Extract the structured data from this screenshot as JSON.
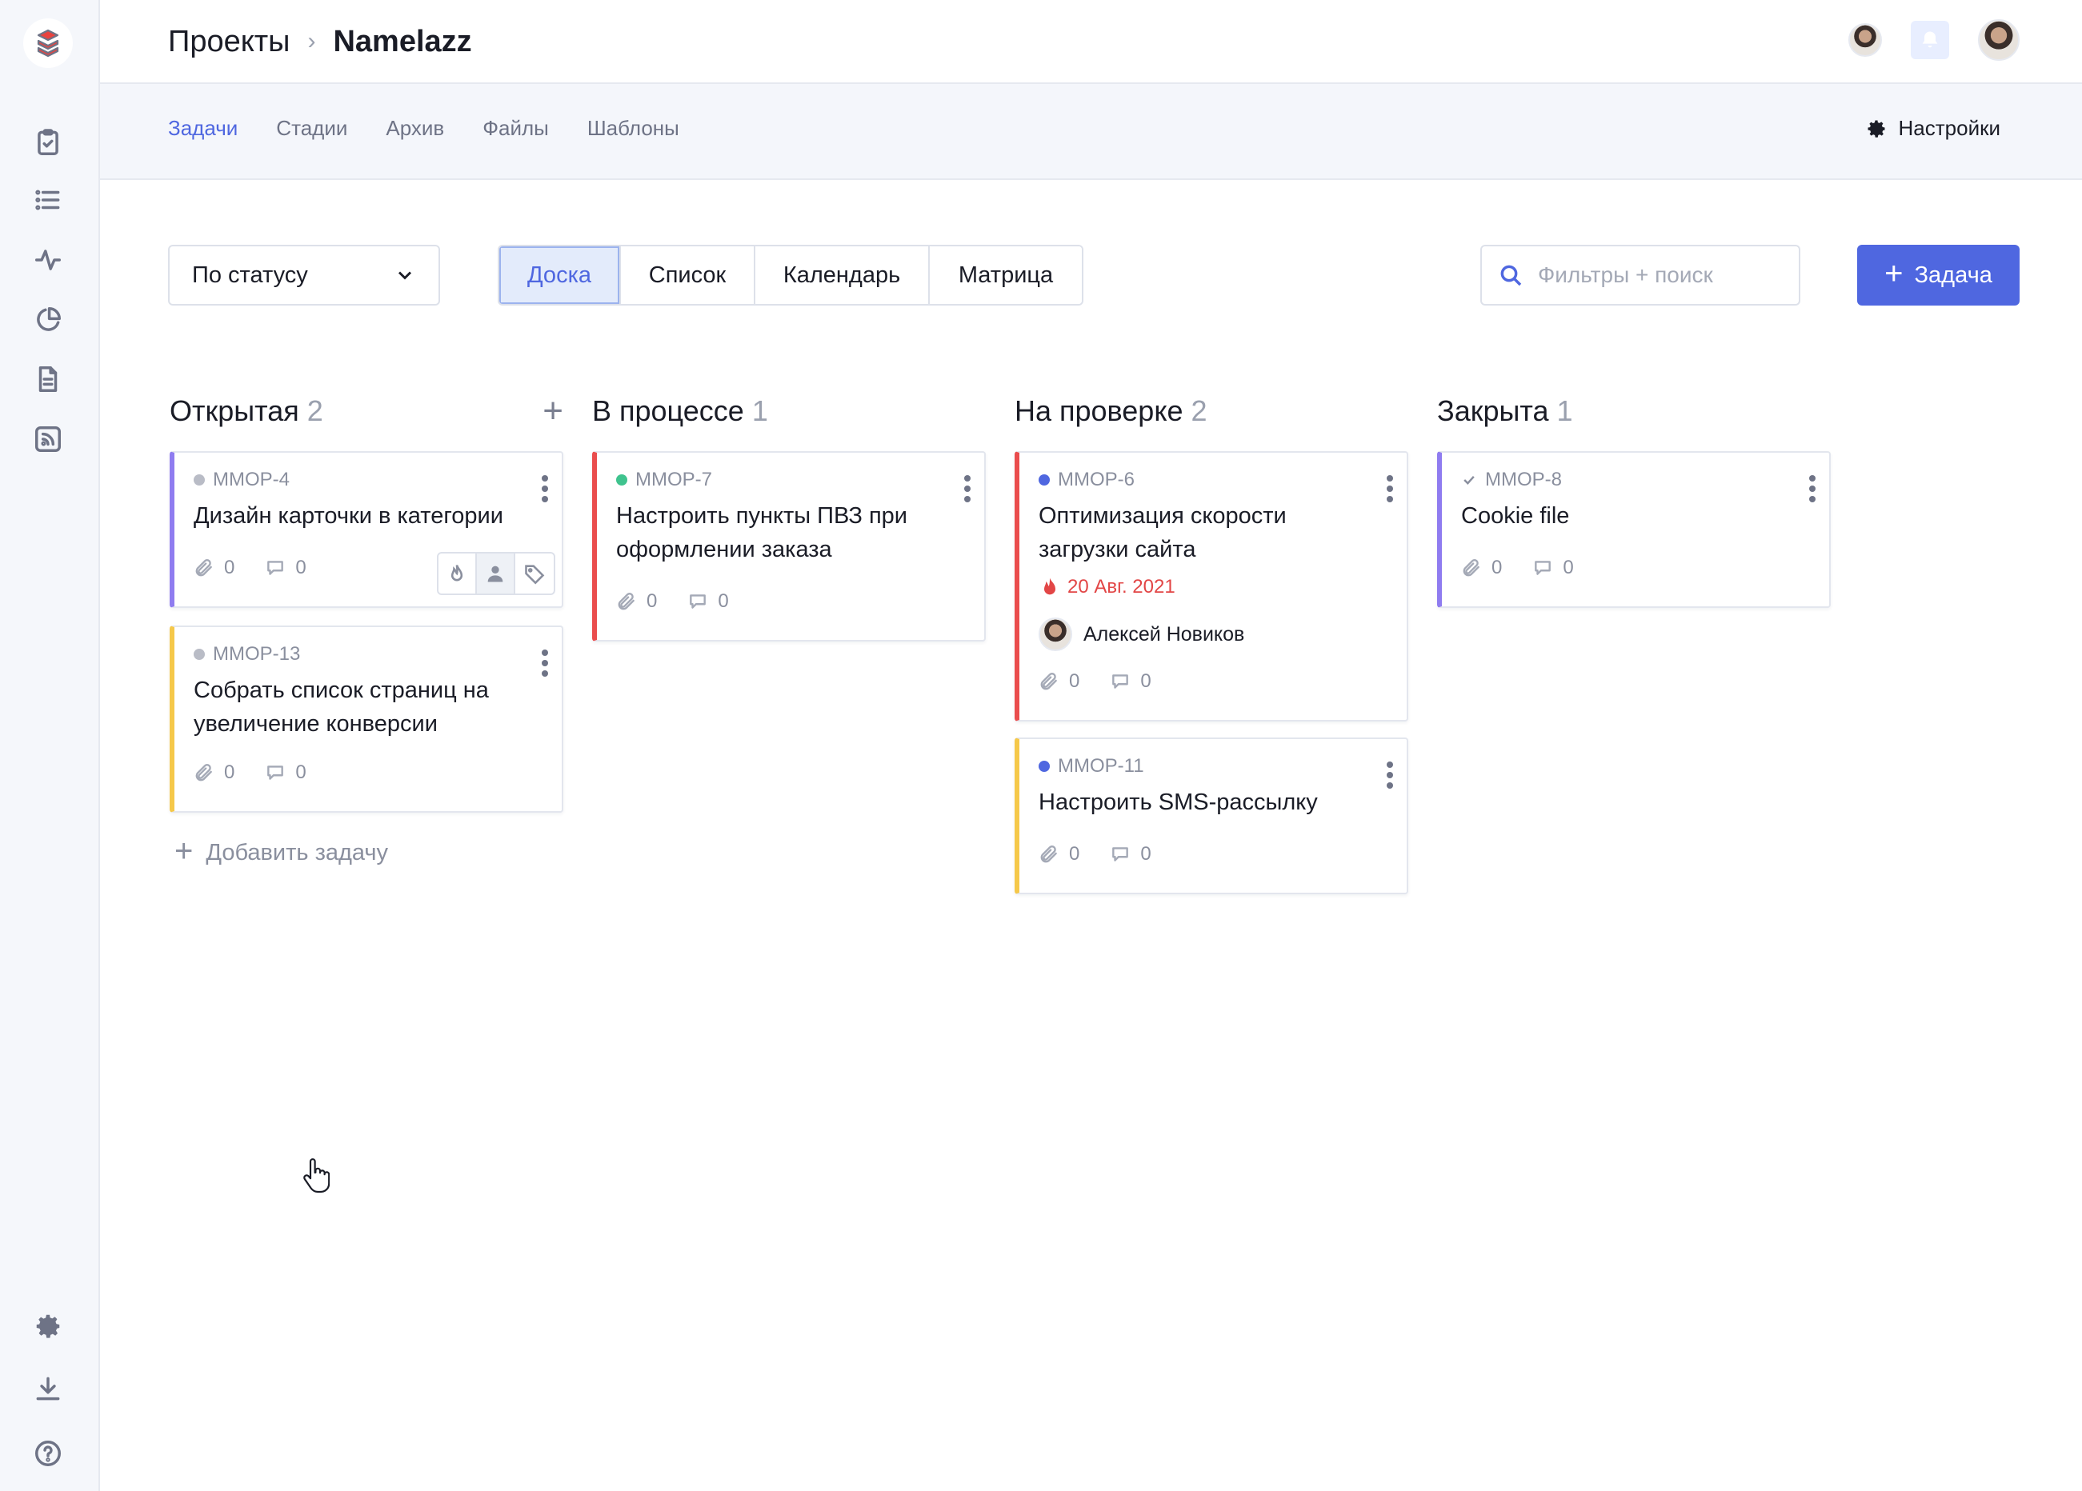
{
  "breadcrumb": {
    "root": "Проекты",
    "current": "Namelazz"
  },
  "tabs": [
    {
      "label": "Задачи",
      "active": true
    },
    {
      "label": "Стадии",
      "active": false
    },
    {
      "label": "Архив",
      "active": false
    },
    {
      "label": "Файлы",
      "active": false
    },
    {
      "label": "Шаблоны",
      "active": false
    }
  ],
  "settings_label": "Настройки",
  "toolbar": {
    "group_by": "По статусу",
    "views": [
      "Доска",
      "Список",
      "Календарь",
      "Матрица"
    ],
    "active_view": "Доска",
    "search_placeholder": "Фильтры + поиск",
    "add_task_label": "Задача"
  },
  "columns": [
    {
      "title": "Открытая",
      "count": "2",
      "cards": [
        {
          "code": "MMOP-4",
          "status_dot": "#b9bcc6",
          "title": "Дизайн карточки в категории",
          "border": "#8f7cf0",
          "attachments": "0",
          "comments": "0"
        },
        {
          "code": "MMOP-13",
          "status_dot": "#b9bcc6",
          "title": "Собрать список страниц на увеличение конверсии",
          "border": "#f5c84a",
          "attachments": "0",
          "comments": "0"
        }
      ],
      "add_label": "Добавить задачу"
    },
    {
      "title": "В процессе",
      "count": "1",
      "cards": [
        {
          "code": "MMOP-7",
          "status_dot": "#3fc38e",
          "title": "Настроить пункты ПВЗ при оформлении заказа",
          "border": "#ea4d4d",
          "attachments": "0",
          "comments": "0"
        }
      ]
    },
    {
      "title": "На проверке",
      "count": "2",
      "cards": [
        {
          "code": "MMOP-6",
          "status_dot": "#4f67e0",
          "title": "Оптимизация скорости загрузки сайта",
          "border": "#ea4d4d",
          "due": "20 Авг. 2021",
          "assignee": "Алексей Новиков",
          "attachments": "0",
          "comments": "0"
        },
        {
          "code": "MMOP-11",
          "status_dot": "#4f67e0",
          "title": "Настроить SMS-рассылку",
          "border": "#f5c84a",
          "attachments": "0",
          "comments": "0"
        }
      ]
    },
    {
      "title": "Закрыта",
      "count": "1",
      "cards": [
        {
          "code": "MMOP-8",
          "status_icon": "check-icon",
          "title": "Cookie file",
          "border": "#8f7cf0",
          "attachments": "0",
          "comments": "0"
        }
      ]
    }
  ],
  "colors": {
    "accent": "#4f67e0",
    "danger": "#e24646",
    "logo": "#e8433f"
  }
}
